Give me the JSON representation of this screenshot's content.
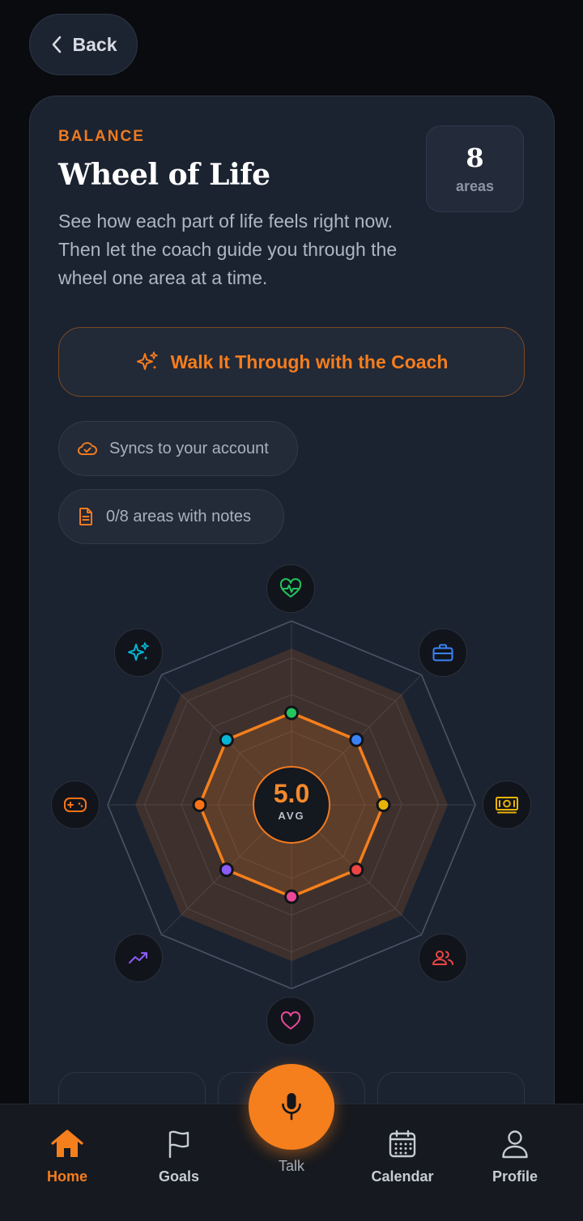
{
  "nav": {
    "back_label": "Back"
  },
  "header": {
    "eyebrow": "BALANCE",
    "title": "Wheel of Life",
    "description": "See how each part of life feels right now. Then let the coach guide you through the wheel one area at a time.",
    "area_count": "8",
    "area_count_unit": "areas"
  },
  "coach_button": {
    "label": "Walk It Through with the Coach"
  },
  "status": {
    "sync_label": "Syncs to your account",
    "notes_label": "0/8 areas with notes"
  },
  "wheel": {
    "average_value": "5.0",
    "average_label": "AVG",
    "scale_max": 10,
    "ideal_level": 8.5,
    "areas": [
      {
        "icon": "heart-pulse-icon",
        "color": "#22c55e",
        "score": 5
      },
      {
        "icon": "briefcase-icon",
        "color": "#3b82f6",
        "score": 5
      },
      {
        "icon": "money-icon",
        "color": "#eab308",
        "score": 5
      },
      {
        "icon": "people-icon",
        "color": "#ef4444",
        "score": 5
      },
      {
        "icon": "heart-icon",
        "color": "#ec4899",
        "score": 5
      },
      {
        "icon": "trending-up-icon",
        "color": "#8b5cf6",
        "score": 5
      },
      {
        "icon": "gamepad-icon",
        "color": "#f97316",
        "score": 5
      },
      {
        "icon": "sparkles-icon",
        "color": "#06b6d4",
        "score": 5
      }
    ]
  },
  "tabs": [
    {
      "label": "Home",
      "icon": "home-icon"
    },
    {
      "label": "Goals",
      "icon": "flag-icon"
    },
    {
      "label": "Talk",
      "icon": "mic-icon"
    },
    {
      "label": "Calendar",
      "icon": "calendar-icon"
    },
    {
      "label": "Profile",
      "icon": "user-icon"
    }
  ],
  "colors": {
    "accent": "#f57f1c",
    "background": "#090b0f",
    "card": "#1c2330"
  }
}
